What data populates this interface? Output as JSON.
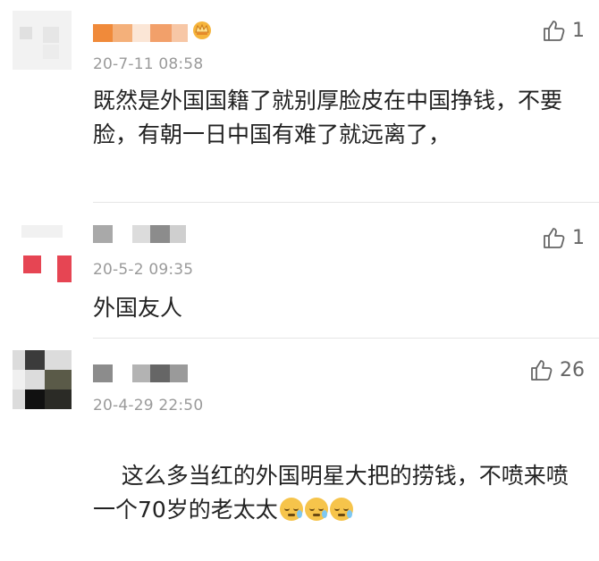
{
  "comments": [
    {
      "time": "20-7-11 08:58",
      "text": "既然是外国国籍了就别厚脸皮在中国挣钱，不要脸，有朝一日中国有难了就远离了，",
      "likes": "1"
    },
    {
      "time": "20-5-2 09:35",
      "text": "外国友人",
      "likes": "1"
    },
    {
      "time": "20-4-29 22:50",
      "text": "这么多当红的外国明星大把的捞钱，不喷来喷一个70岁的老太太",
      "likes": "26"
    }
  ],
  "icons": {
    "like": "thumbs-up-icon",
    "vip": "crown-badge-icon",
    "emoji": "cold-sweat-emoji-icon"
  },
  "colors": {
    "text": "#222222",
    "meta": "#9a9a9a",
    "divider": "#e6e6e6"
  }
}
